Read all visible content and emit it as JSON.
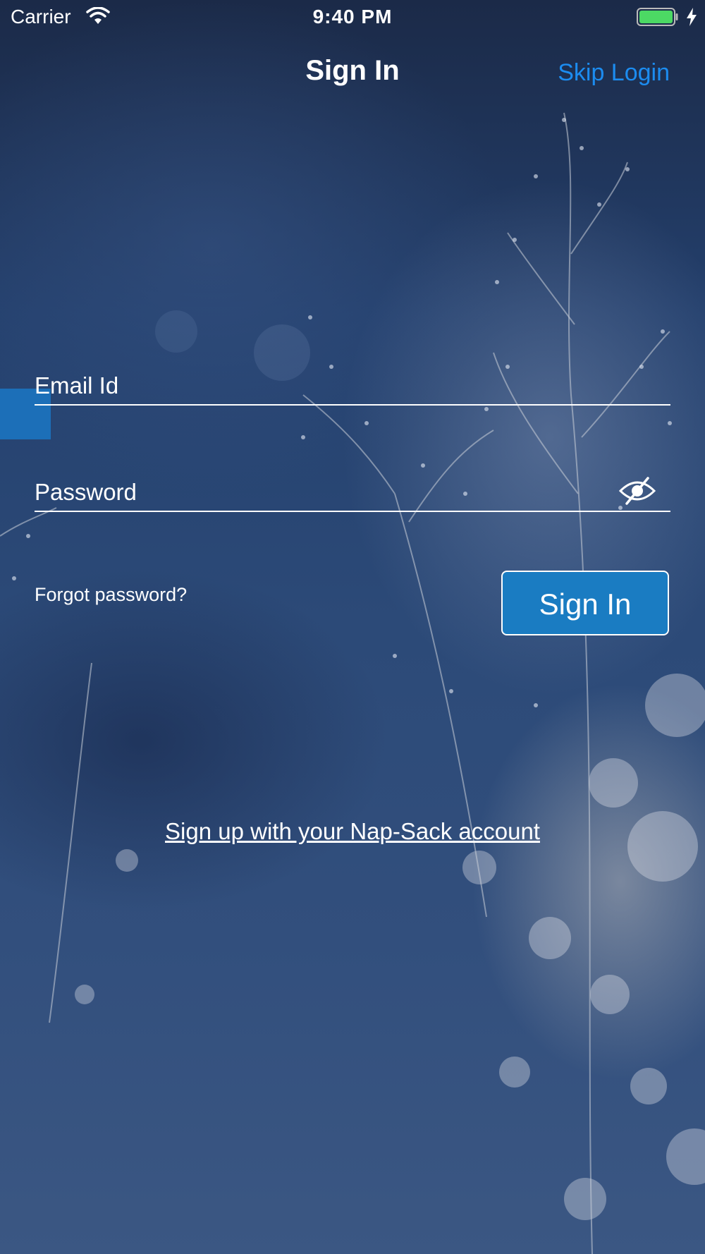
{
  "status_bar": {
    "carrier": "Carrier",
    "time": "9:40 PM",
    "wifi_icon": "wifi-icon",
    "battery_icon": "battery-icon",
    "charging_icon": "charging-bolt-icon",
    "battery_color": "#4cd964"
  },
  "nav": {
    "title": "Sign In",
    "skip_label": "Skip Login"
  },
  "form": {
    "email_placeholder": "Email Id",
    "password_placeholder": "Password",
    "password_toggle_icon": "eye-slash-icon",
    "forgot_label": "Forgot password?",
    "sign_in_label": "Sign In"
  },
  "signup": {
    "label": "Sign up with your Nap-Sack account"
  },
  "colors": {
    "accent": "#1a7cc2",
    "link": "#1c8cf0",
    "text": "#ffffff"
  }
}
